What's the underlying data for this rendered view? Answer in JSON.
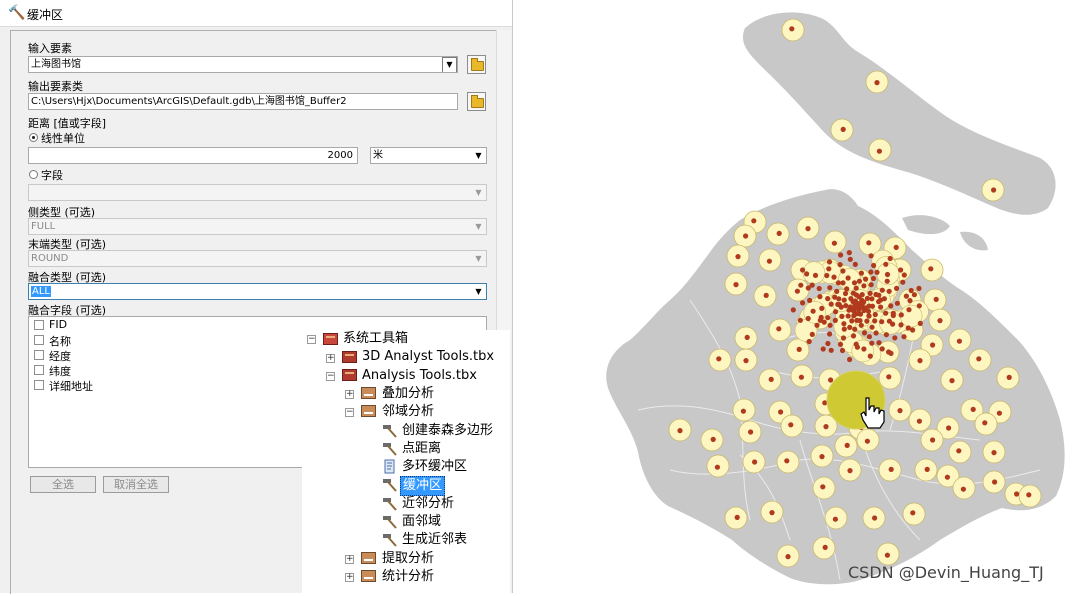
{
  "window": {
    "title": "缓冲区"
  },
  "form": {
    "input_features_label": "输入要素",
    "input_features_value": "上海图书馆",
    "output_label": "输出要素类",
    "output_value": "C:\\Users\\Hjx\\Documents\\ArcGIS\\Default.gdb\\上海图书馆_Buffer2",
    "distance_label": "距离 [值或字段]",
    "linear_unit_label": "线性单位",
    "distance_value": "2000",
    "unit_value": "米",
    "field_label": "字段",
    "side_type_label": "侧类型 (可选)",
    "side_type_value": "FULL",
    "end_type_label": "末端类型 (可选)",
    "end_type_value": "ROUND",
    "dissolve_type_label": "融合类型 (可选)",
    "dissolve_type_value": "ALL",
    "dissolve_field_label": "融合字段 (可选)",
    "fields": [
      "FID",
      "名称",
      "经度",
      "纬度",
      "详细地址"
    ],
    "select_all_label": "全选",
    "clear_all_label": "取消全选"
  },
  "tree": {
    "root": "系统工具箱",
    "items": {
      "analyst3d": "3D Analyst Tools.tbx",
      "analysis": "Analysis Tools.tbx",
      "overlay": "叠加分析",
      "proximity": "邻域分析",
      "thiessen": "创建泰森多边形",
      "point_distance": "点距离",
      "multi_ring": "多环缓冲区",
      "buffer": "缓冲区",
      "near": "近邻分析",
      "polygon_neighbors": "面邻域",
      "near_table": "生成近邻表",
      "extract": "提取分析",
      "statistics": "统计分析"
    }
  },
  "map": {
    "land_color": "#c8c8c8",
    "buffer_color": "#fdf6c0",
    "buffer_outline": "#c9b86a",
    "point_color": "#b03a1e",
    "highlight_color": "#cfca33"
  },
  "watermark": "CSDN @Devin_Huang_TJ"
}
